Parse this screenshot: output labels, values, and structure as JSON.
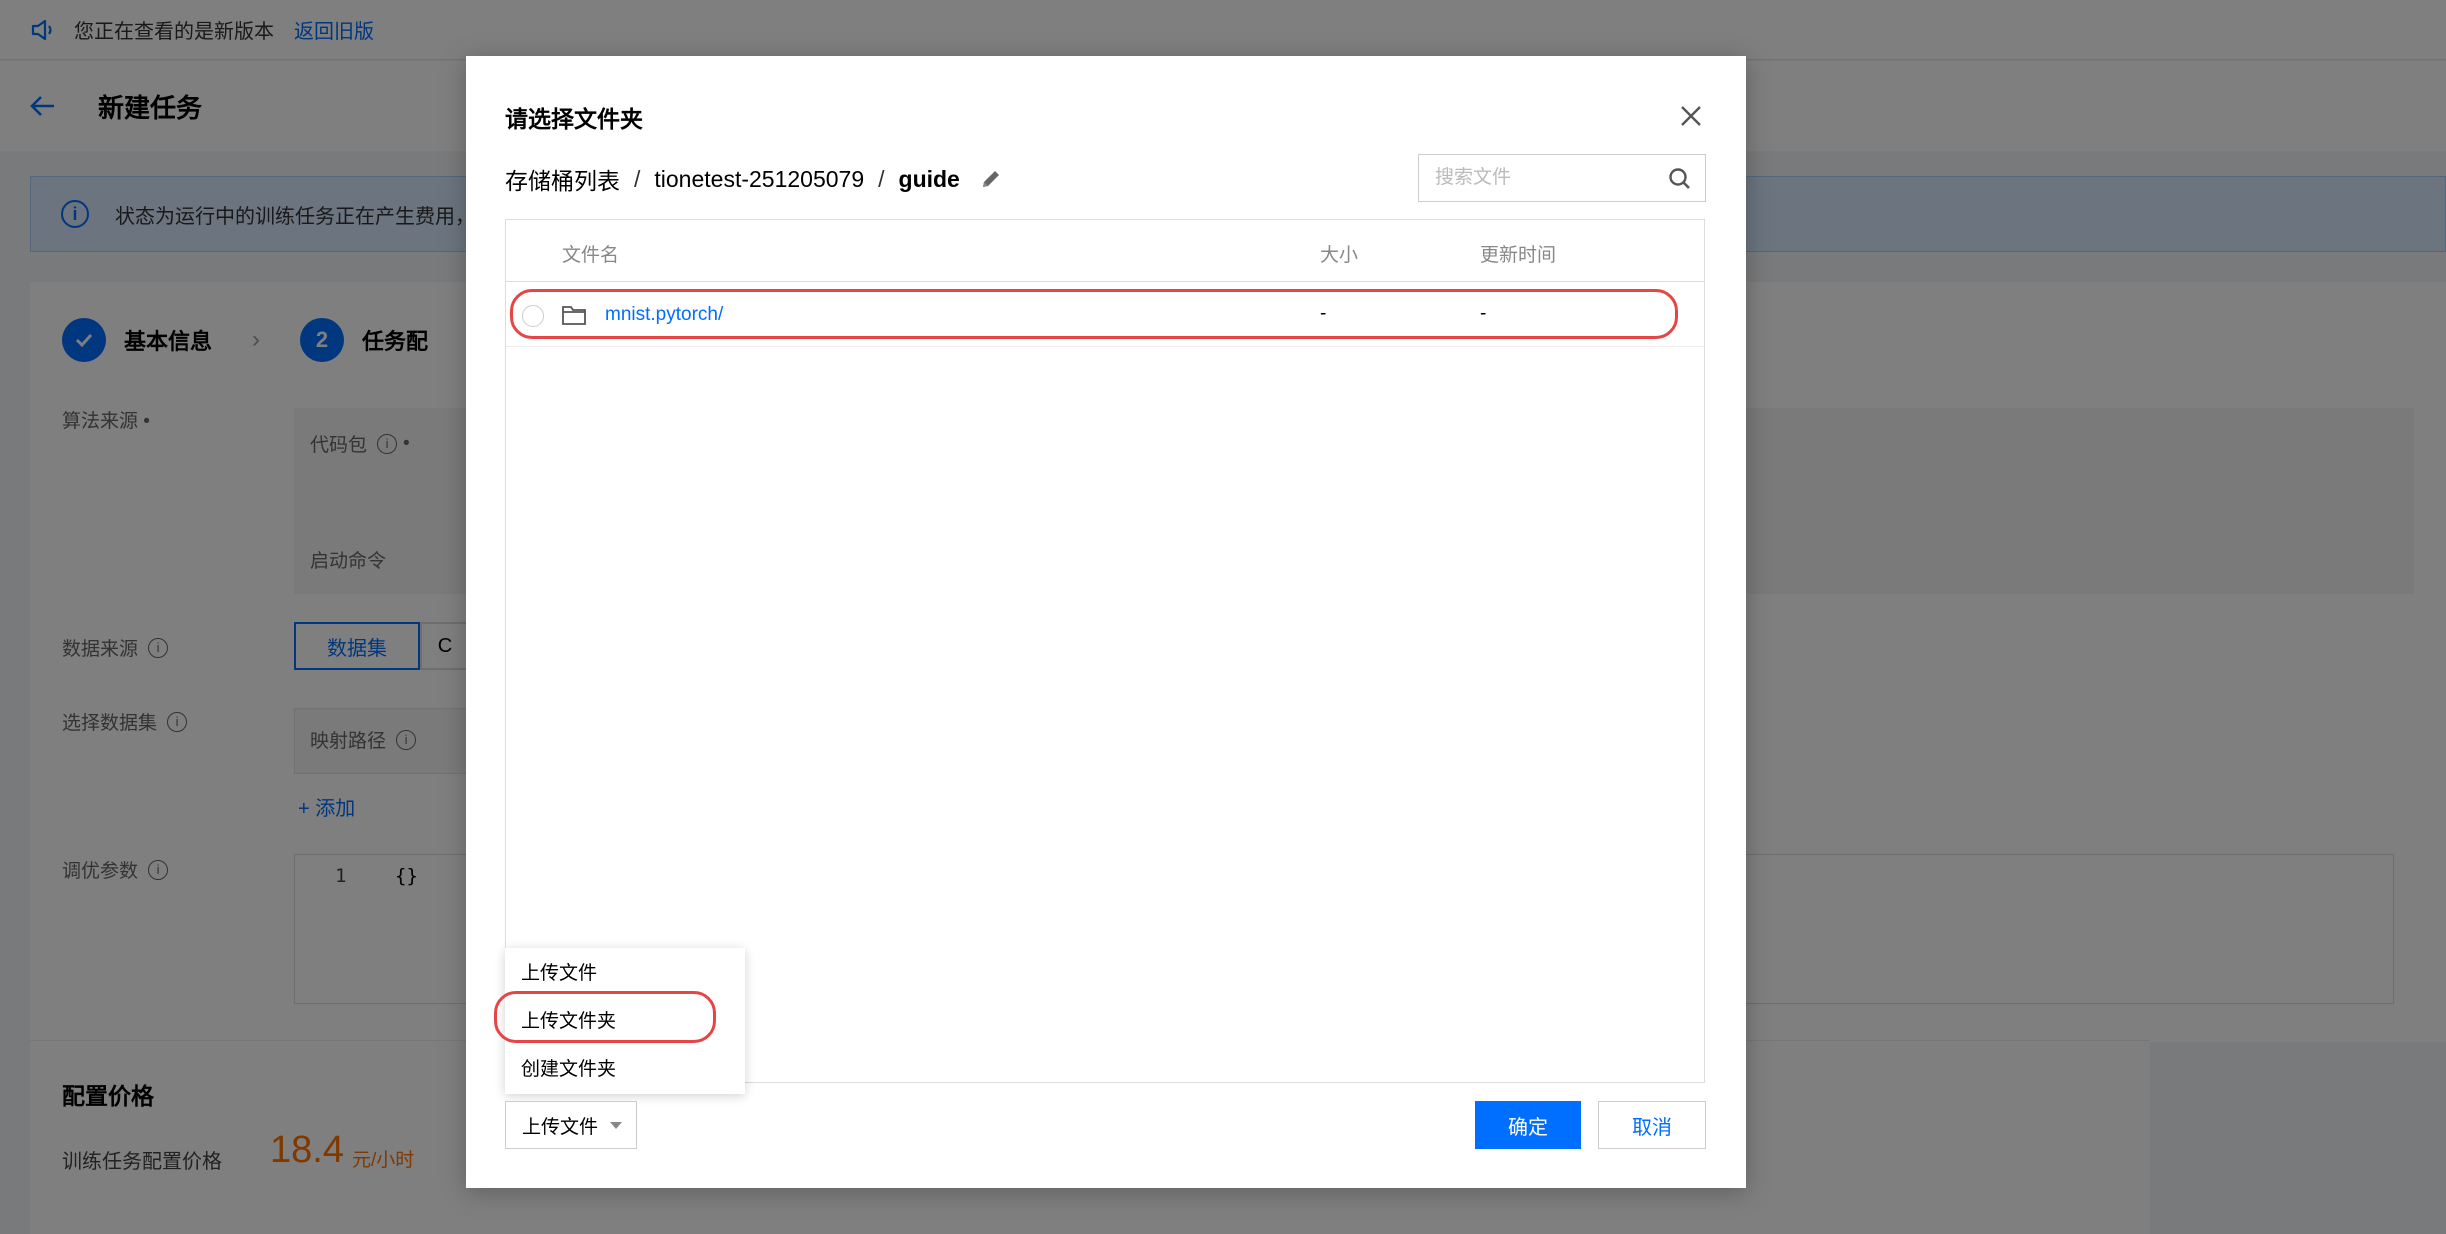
{
  "notice": {
    "text": "您正在查看的是新版本",
    "link": "返回旧版"
  },
  "header": {
    "title": "新建任务"
  },
  "banner": {
    "text": "状态为运行中的训练任务正在产生费用，"
  },
  "steps": [
    {
      "label": "基本信息",
      "state": "done"
    },
    {
      "number": "2",
      "label": "任务配"
    }
  ],
  "form": {
    "algo_source_label": "算法来源 •",
    "code_pkg_label": "代码包",
    "code_pkg_required": "•",
    "start_cmd_label": "启动命令",
    "data_source_label": "数据来源",
    "data_source_options": [
      "数据集",
      "C"
    ],
    "select_dataset_label": "选择数据集",
    "map_path_label": "映射路径",
    "add_label": "+ 添加",
    "tune_params_label": "调优参数",
    "code_line_no": "1",
    "code_content": "{}"
  },
  "price": {
    "title": "配置价格",
    "label": "训练任务配置价格",
    "value": "18.4",
    "unit": "元/小时"
  },
  "modal": {
    "title": "请选择文件夹",
    "breadcrumb": [
      "存储桶列表",
      "tionetest-251205079",
      "guide"
    ],
    "breadcrumb_sep": "/",
    "search_placeholder": "搜索文件",
    "columns": {
      "name": "文件名",
      "size": "大小",
      "time": "更新时间"
    },
    "rows": [
      {
        "name": "mnist.pytorch/",
        "size": "-",
        "time": "-"
      }
    ],
    "upload_menu": [
      "上传文件",
      "上传文件夹",
      "创建文件夹"
    ],
    "upload_button": "上传文件",
    "ok_button": "确定",
    "cancel_button": "取消"
  },
  "colors": {
    "accent": "#006eff",
    "highlight": "#e54545",
    "price": "#ff7200"
  }
}
